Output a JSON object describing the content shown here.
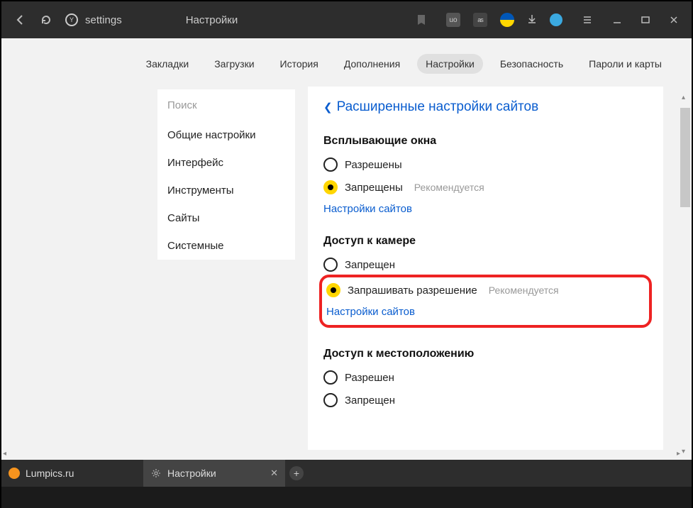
{
  "titlebar": {
    "url_text": "settings",
    "page_title": "Настройки"
  },
  "topnav": {
    "items": [
      {
        "label": "Закладки"
      },
      {
        "label": "Загрузки"
      },
      {
        "label": "История"
      },
      {
        "label": "Дополнения"
      },
      {
        "label": "Настройки"
      },
      {
        "label": "Безопасность"
      },
      {
        "label": "Пароли и карты"
      }
    ]
  },
  "sidebar": {
    "search_placeholder": "Поиск",
    "items": [
      {
        "label": "Общие настройки"
      },
      {
        "label": "Интерфейс"
      },
      {
        "label": "Инструменты"
      },
      {
        "label": "Сайты"
      },
      {
        "label": "Системные"
      }
    ]
  },
  "panel": {
    "title": "Расширенные настройки сайтов",
    "sections": [
      {
        "heading": "Всплывающие окна",
        "options": [
          {
            "label": "Разрешены",
            "selected": false,
            "recommended": ""
          },
          {
            "label": "Запрещены",
            "selected": true,
            "recommended": "Рекомендуется"
          }
        ],
        "link": "Настройки сайтов"
      },
      {
        "heading": "Доступ к камере",
        "options": [
          {
            "label": "Запрещен",
            "selected": false,
            "recommended": ""
          },
          {
            "label": "Запрашивать разрешение",
            "selected": true,
            "recommended": "Рекомендуется"
          }
        ],
        "link": "Настройки сайтов",
        "highlighted": true
      },
      {
        "heading": "Доступ к местоположению",
        "options": [
          {
            "label": "Разрешен",
            "selected": false,
            "recommended": ""
          },
          {
            "label": "Запрещен",
            "selected": false,
            "recommended": ""
          }
        ],
        "link": ""
      }
    ]
  },
  "tabs": [
    {
      "label": "Lumpics.ru",
      "icon": "lumpics"
    },
    {
      "label": "Настройки",
      "icon": "settings"
    }
  ]
}
